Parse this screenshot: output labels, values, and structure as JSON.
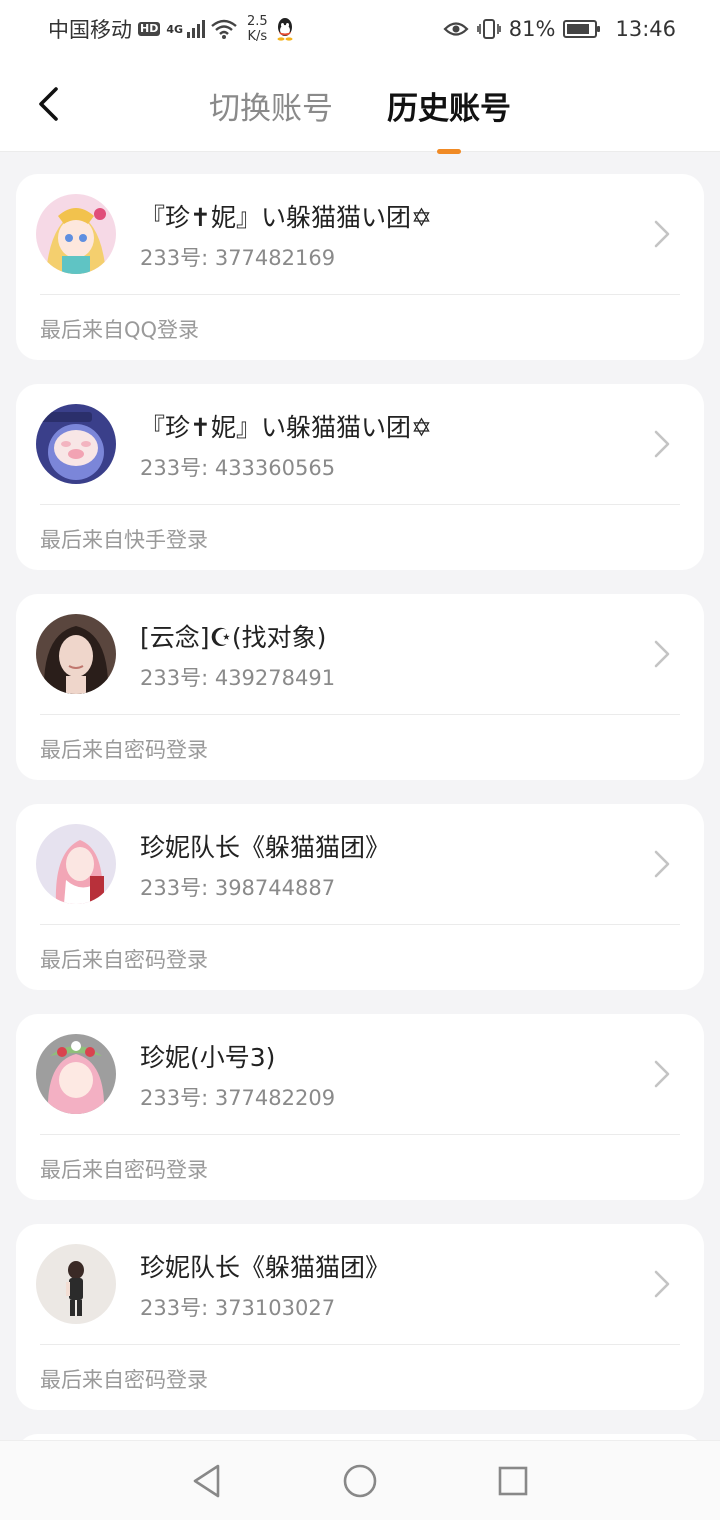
{
  "status_bar": {
    "carrier": "中国移动",
    "hd": "HD",
    "network_type": "4G",
    "speed_value": "2.5",
    "speed_unit": "K/s",
    "battery_percent": "81%",
    "battery_level": 0.81,
    "time": "13:46"
  },
  "header": {
    "tabs": [
      {
        "label": "切换账号",
        "active": false
      },
      {
        "label": "历史账号",
        "active": true
      }
    ],
    "accent_color": "#f08a25"
  },
  "accounts": [
    {
      "name": "『珍✝妮』い躲猫猫い团✡",
      "uid": "233号: 377482169",
      "last_login": "最后来自QQ登录"
    },
    {
      "name": "『珍✝妮』い躲猫猫い团✡",
      "uid": "233号: 433360565",
      "last_login": "最后来自快手登录"
    },
    {
      "name": "[云念]☪(找对象)",
      "uid": "233号: 439278491",
      "last_login": "最后来自密码登录"
    },
    {
      "name": "珍妮队长《躲猫猫团》",
      "uid": "233号: 398744887",
      "last_login": "最后来自密码登录"
    },
    {
      "name": "珍妮(小号3)",
      "uid": "233号: 377482209",
      "last_login": "最后来自密码登录"
    },
    {
      "name": "珍妮队长《躲猫猫团》",
      "uid": "233号: 373103027",
      "last_login": "最后来自密码登录"
    }
  ],
  "icons": {
    "back": "chevron-left-icon",
    "row_arrow": "chevron-right-icon",
    "nav_back": "triangle-back-icon",
    "nav_home": "circle-home-icon",
    "nav_recent": "square-recents-icon"
  }
}
